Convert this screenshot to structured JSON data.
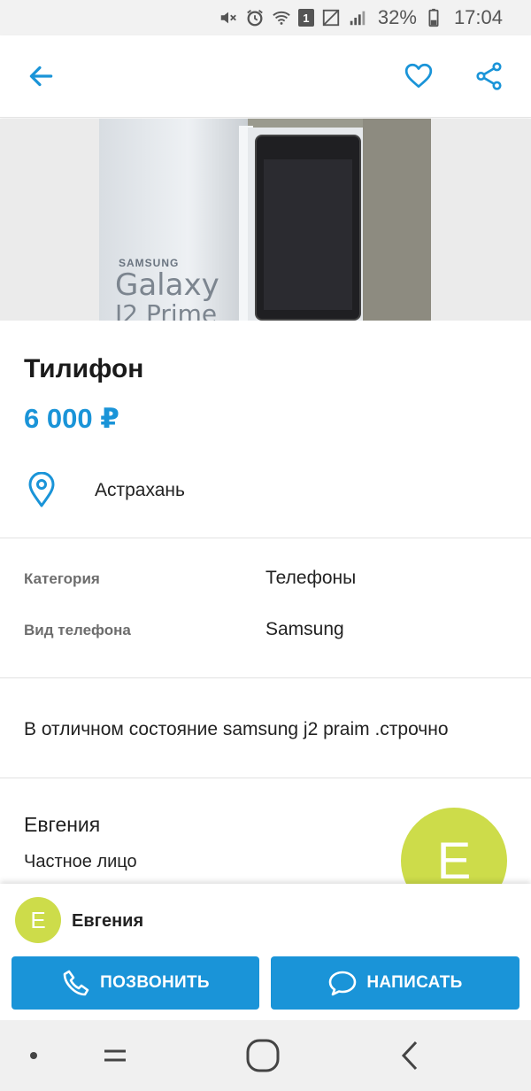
{
  "status_bar": {
    "battery": "32%",
    "time": "17:04",
    "sim_badge": "1",
    "icons": [
      "mute-icon",
      "alarm-icon",
      "wifi-icon",
      "sim-icon",
      "no-signal-icon",
      "signal-icon",
      "battery-icon"
    ]
  },
  "app_bar": {
    "icons": [
      "back-arrow-icon",
      "heart-icon",
      "share-icon"
    ],
    "accent_color": "#1a94d8"
  },
  "listing": {
    "photo": {
      "brand_text": "SAMSUNG",
      "model_text": "Galaxy",
      "model_sub_text": "J2 Prime"
    },
    "title": "Тилифон",
    "price": "6 000 ₽",
    "location": "Астрахань",
    "params": [
      {
        "label": "Категория",
        "value": "Телефоны"
      },
      {
        "label": "Вид телефона",
        "value": "Samsung"
      }
    ],
    "description": "В отличном состояние samsung j2 praim .строчно"
  },
  "seller": {
    "name": "Евгения",
    "type": "Частное лицо",
    "avatar_letter": "E",
    "avatar_color": "#cddc4a"
  },
  "actions": {
    "call_label": "ПОЗВОНИТЬ",
    "write_label": "НАПИСАТЬ",
    "button_color": "#1a94d8"
  },
  "nav_bar": {
    "icons": [
      "dot-icon",
      "recents-icon",
      "home-icon",
      "back-icon"
    ]
  }
}
